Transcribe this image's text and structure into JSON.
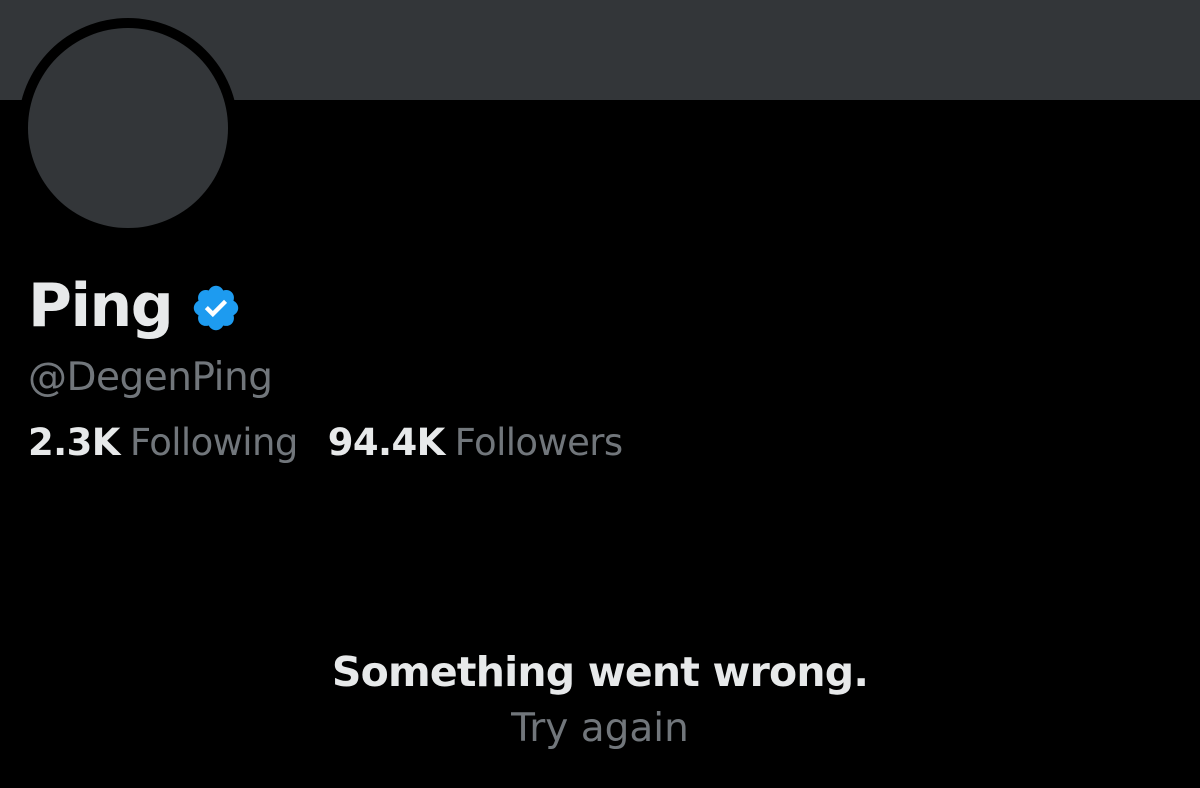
{
  "profile": {
    "display_name": "Ping",
    "handle": "@DegenPing",
    "verified_icon": "verified-badge-icon",
    "following_count": "2.3K",
    "following_label": "Following",
    "followers_count": "94.4K",
    "followers_label": "Followers"
  },
  "error": {
    "message": "Something went wrong.",
    "retry_label": "Try again"
  },
  "colors": {
    "background": "#000000",
    "banner": "#333639",
    "primary_text": "#e7e9ea",
    "secondary_text": "#71767b",
    "verified_blue": "#1d9bf0"
  }
}
